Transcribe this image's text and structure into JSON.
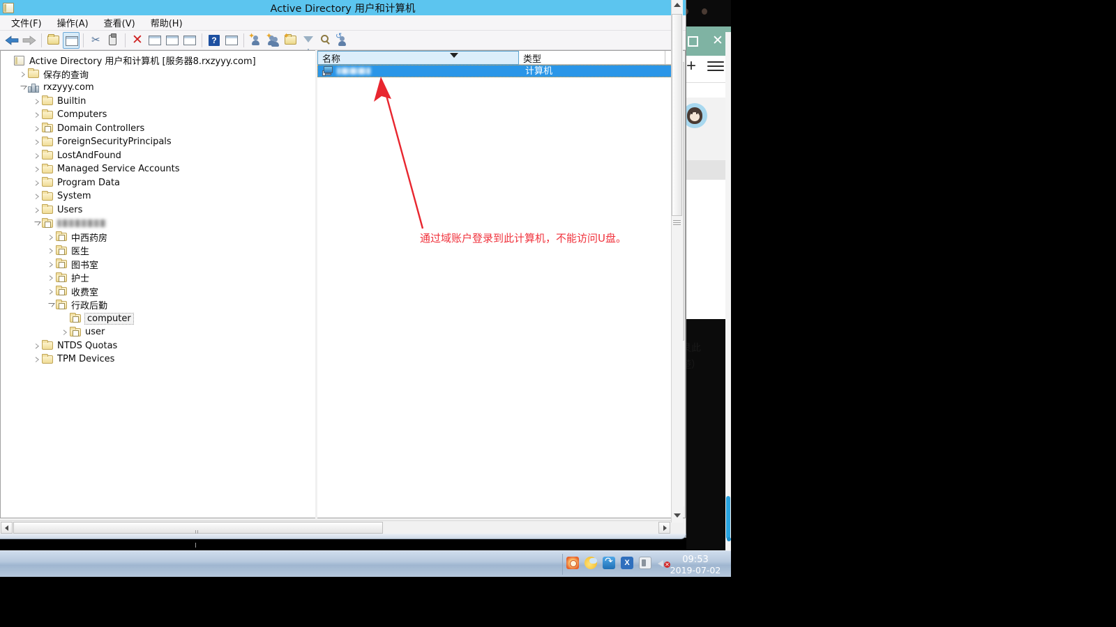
{
  "window": {
    "title": "Active Directory 用户和计算机",
    "title_icon": "console-icon"
  },
  "menu": {
    "items": [
      {
        "label": "文件(F)",
        "name": "menu-file"
      },
      {
        "label": "操作(A)",
        "name": "menu-action"
      },
      {
        "label": "查看(V)",
        "name": "menu-view"
      },
      {
        "label": "帮助(H)",
        "name": "menu-help"
      }
    ]
  },
  "toolbar": {
    "buttons": [
      {
        "name": "back-icon",
        "glyph": "←"
      },
      {
        "name": "forward-icon",
        "glyph": "→"
      },
      {
        "name": "up-one-level-icon",
        "glyph": "folder-up"
      },
      {
        "name": "show-hide-console-tree-icon",
        "glyph": "console-tree"
      },
      {
        "name": "cut-icon",
        "glyph": "✄"
      },
      {
        "name": "paste-icon",
        "glyph": "clipboard"
      },
      {
        "name": "delete-icon",
        "glyph": "✕"
      },
      {
        "name": "properties-icon",
        "glyph": "properties"
      },
      {
        "name": "refresh-icon",
        "glyph": "refresh"
      },
      {
        "name": "export-list-icon",
        "glyph": "export"
      },
      {
        "name": "help-icon",
        "glyph": "?"
      },
      {
        "name": "show-action-pane-icon",
        "glyph": "action-pane"
      },
      {
        "name": "new-user-icon",
        "glyph": "new-user"
      },
      {
        "name": "new-group-icon",
        "glyph": "new-group"
      },
      {
        "name": "new-organizational-unit-icon",
        "glyph": "new-ou"
      },
      {
        "name": "filter-icon",
        "glyph": "funnel"
      },
      {
        "name": "find-icon",
        "glyph": "magnifier"
      },
      {
        "name": "set-domain-icon",
        "glyph": "domain-users"
      }
    ]
  },
  "tree": {
    "nodes": [
      {
        "label": "Active Directory 用户和计算机 [服务器8.rxzyyy.com]",
        "icon": "console-root-icon",
        "indent": 0,
        "state": "none",
        "name": "tree-item-root"
      },
      {
        "label": "保存的查询",
        "icon": "folder-icon",
        "indent": 1,
        "state": "collapsed",
        "name": "tree-item-saved-queries"
      },
      {
        "label": "rxzyyy.com",
        "icon": "domain-icon",
        "indent": 1,
        "state": "expanded",
        "name": "tree-item-domain"
      },
      {
        "label": "Builtin",
        "icon": "folder-icon",
        "indent": 2,
        "state": "collapsed",
        "name": "tree-item-builtin"
      },
      {
        "label": "Computers",
        "icon": "folder-icon",
        "indent": 2,
        "state": "collapsed",
        "name": "tree-item-computers"
      },
      {
        "label": "Domain Controllers",
        "icon": "ou-icon",
        "indent": 2,
        "state": "collapsed",
        "name": "tree-item-domain-controllers"
      },
      {
        "label": "ForeignSecurityPrincipals",
        "icon": "folder-icon",
        "indent": 2,
        "state": "collapsed",
        "name": "tree-item-foreign-security-principals"
      },
      {
        "label": "LostAndFound",
        "icon": "folder-icon",
        "indent": 2,
        "state": "collapsed",
        "name": "tree-item-lost-and-found"
      },
      {
        "label": "Managed Service Accounts",
        "icon": "folder-icon",
        "indent": 2,
        "state": "collapsed",
        "name": "tree-item-managed-service-accounts"
      },
      {
        "label": "Program Data",
        "icon": "folder-icon",
        "indent": 2,
        "state": "collapsed",
        "name": "tree-item-program-data"
      },
      {
        "label": "System",
        "icon": "folder-icon",
        "indent": 2,
        "state": "collapsed",
        "name": "tree-item-system"
      },
      {
        "label": "Users",
        "icon": "folder-icon",
        "indent": 2,
        "state": "collapsed",
        "name": "tree-item-users"
      },
      {
        "label": "",
        "redacted": true,
        "icon": "ou-icon",
        "indent": 2,
        "state": "expanded",
        "name": "tree-item-redacted-ou"
      },
      {
        "label": "中西药房",
        "icon": "ou-icon",
        "indent": 3,
        "state": "collapsed",
        "name": "tree-item-zhongxiyaofang"
      },
      {
        "label": "医生",
        "icon": "ou-icon",
        "indent": 3,
        "state": "collapsed",
        "name": "tree-item-yisheng"
      },
      {
        "label": "图书室",
        "icon": "ou-icon",
        "indent": 3,
        "state": "collapsed",
        "name": "tree-item-tushushi"
      },
      {
        "label": "护士",
        "icon": "ou-icon",
        "indent": 3,
        "state": "collapsed",
        "name": "tree-item-hushi"
      },
      {
        "label": "收费室",
        "icon": "ou-icon",
        "indent": 3,
        "state": "collapsed",
        "name": "tree-item-shoufeishi"
      },
      {
        "label": "行政后勤",
        "icon": "ou-icon",
        "indent": 3,
        "state": "expanded",
        "name": "tree-item-xingzhenghouqin"
      },
      {
        "label": "computer",
        "icon": "ou-icon",
        "indent": 4,
        "state": "none",
        "selected": true,
        "name": "tree-item-computer"
      },
      {
        "label": "user",
        "icon": "ou-icon",
        "indent": 4,
        "state": "collapsed",
        "name": "tree-item-user"
      },
      {
        "label": "NTDS Quotas",
        "icon": "folder-icon",
        "indent": 2,
        "state": "collapsed",
        "name": "tree-item-ntds-quotas"
      },
      {
        "label": "TPM Devices",
        "icon": "folder-icon",
        "indent": 2,
        "state": "collapsed",
        "name": "tree-item-tpm-devices"
      }
    ]
  },
  "list": {
    "columns": [
      {
        "label": "名称",
        "name": "column-header-name",
        "sorted": true
      },
      {
        "label": "类型",
        "name": "column-header-type"
      }
    ],
    "rows": [
      {
        "name": "",
        "redacted": true,
        "type": "计算机",
        "icon": "computer-icon",
        "selected": true
      }
    ]
  },
  "annotation": {
    "text": "通过域账户登录到此计算机，不能访问U盘。",
    "color": "#f0323c",
    "arrow_color": "#e8262f"
  },
  "background_window": {
    "maximize_icon": "maximize-icon",
    "close_icon": "close-icon",
    "add_icon": "plus-icon",
    "menu_icon": "hamburger-icon",
    "avatar_icon": "monkey-avatar-icon",
    "clipped_text_1": "艮此",
    "clipped_text_2": "楚）"
  },
  "taskbar": {
    "tray_icons": [
      {
        "name": "tray-security-icon"
      },
      {
        "name": "tray-cloud-icon"
      },
      {
        "name": "tray-sync-icon"
      },
      {
        "name": "tray-excel-icon"
      },
      {
        "name": "tray-device-icon"
      },
      {
        "name": "tray-volume-muted-icon"
      }
    ],
    "time": "09:53",
    "date": "2019-07-02"
  }
}
